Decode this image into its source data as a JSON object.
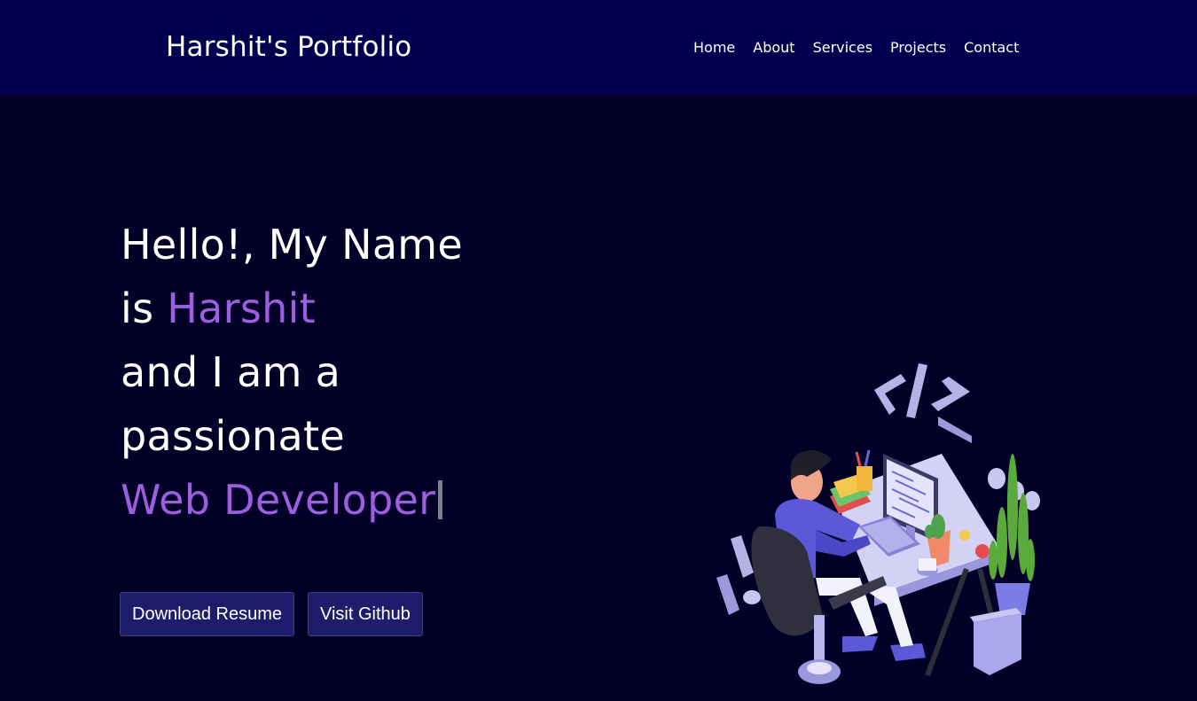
{
  "navbar": {
    "brand": "Harshit's Portfolio",
    "links": [
      {
        "label": "Home"
      },
      {
        "label": "About"
      },
      {
        "label": "Services"
      },
      {
        "label": "Projects"
      },
      {
        "label": "Contact"
      }
    ]
  },
  "hero": {
    "line1": "Hello!, My Name",
    "line2_prefix": "is ",
    "name": "Harshit",
    "line3": "and I am a",
    "line4": "passionate",
    "role": "Web Developer",
    "buttons": {
      "resume": "Download Resume",
      "github": "Visit Github"
    },
    "illustration_icon": "developer-at-desk-illustration"
  },
  "colors": {
    "navbar_bg": "#00004f",
    "page_bg": "#020027",
    "accent": "#9d5ee0",
    "button_bg": "#1d1d6b"
  }
}
